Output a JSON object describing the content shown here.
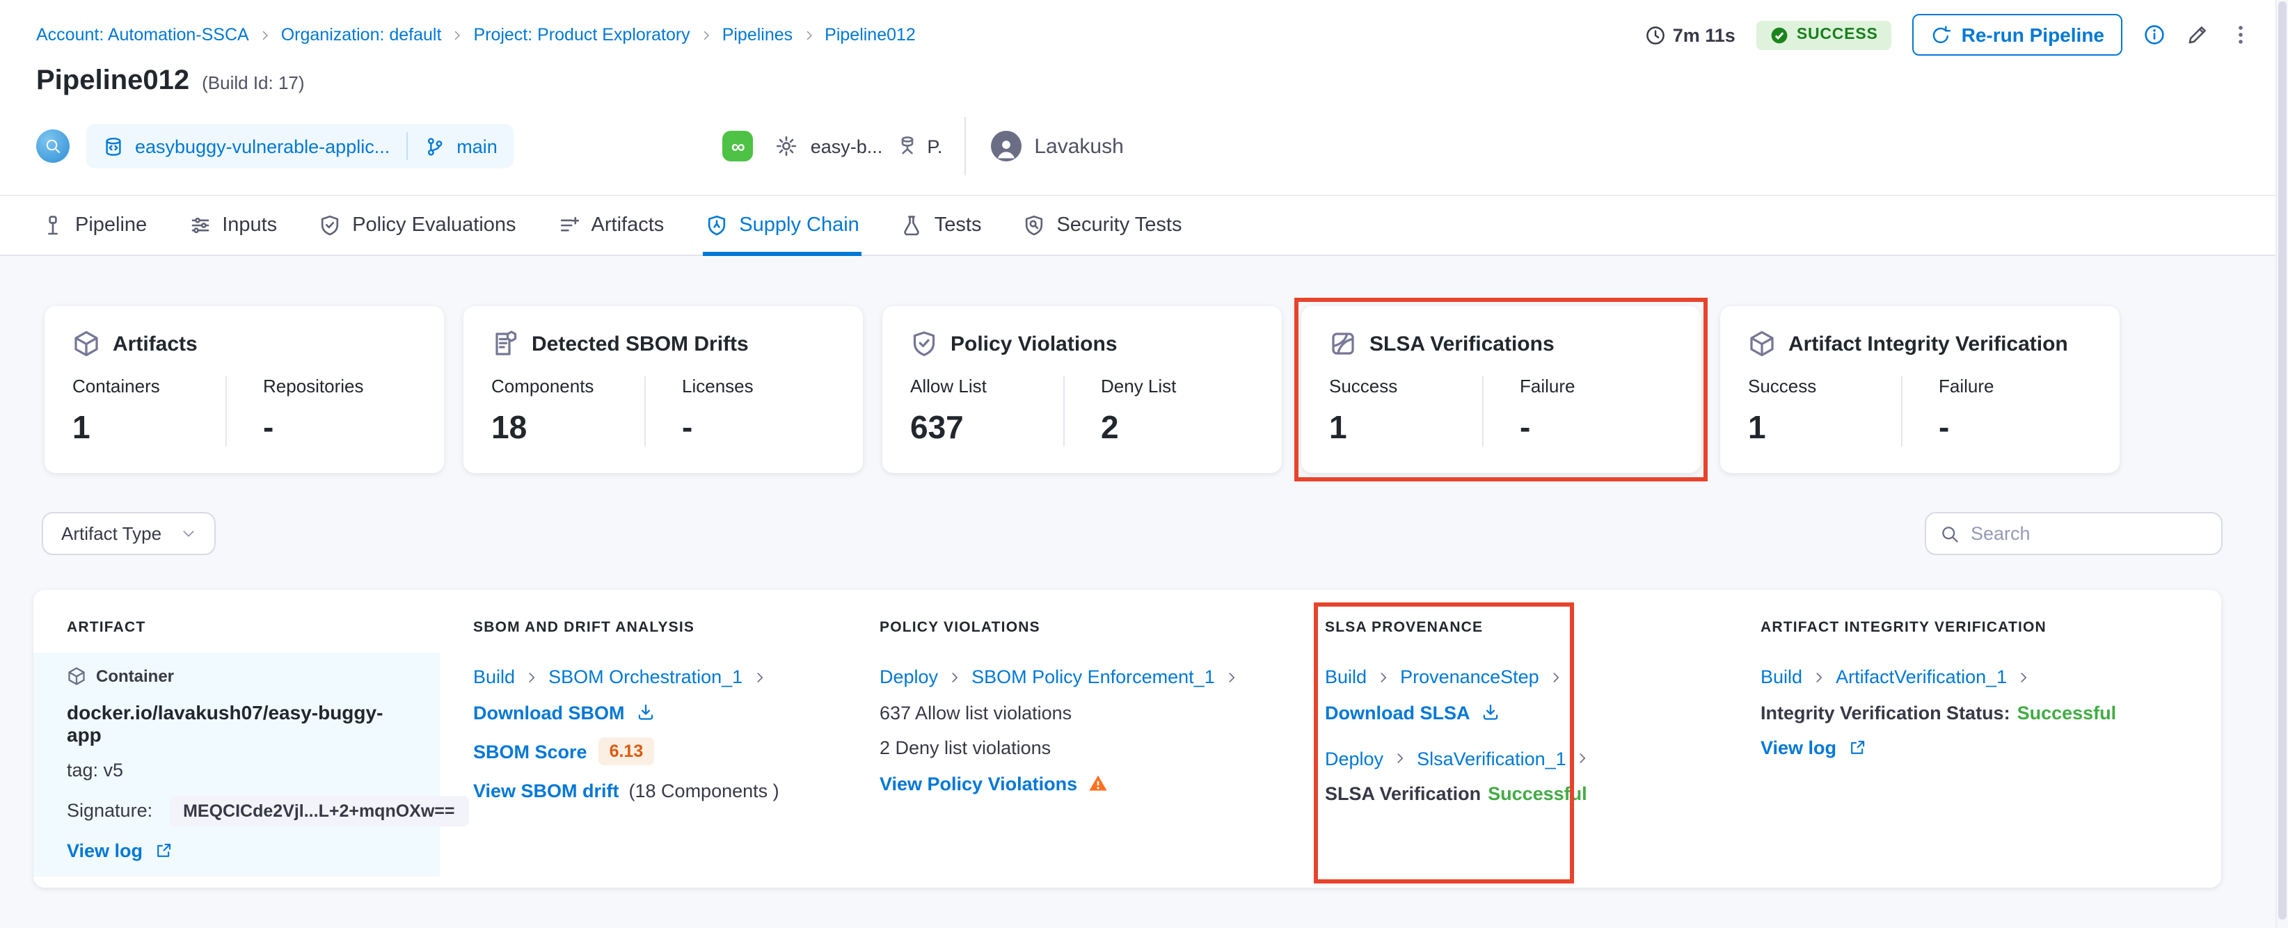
{
  "breadcrumb": {
    "items": [
      "Account: Automation-SSCA",
      "Organization: default",
      "Project: Product Exploratory",
      "Pipelines",
      "Pipeline012"
    ]
  },
  "header": {
    "duration": "7m 11s",
    "status": "SUCCESS",
    "rerun_label": "Re-run Pipeline",
    "title": "Pipeline012",
    "build_id": "(Build Id: 17)",
    "repo": "easybuggy-vulnerable-applic...",
    "branch": "main",
    "trigger_pipeline": "easy-b...",
    "trigger_initial": "P.",
    "user": "Lavakush"
  },
  "tabs": [
    {
      "label": "Pipeline",
      "active": false
    },
    {
      "label": "Inputs",
      "active": false
    },
    {
      "label": "Policy Evaluations",
      "active": false
    },
    {
      "label": "Artifacts",
      "active": false
    },
    {
      "label": "Supply Chain",
      "active": true
    },
    {
      "label": "Tests",
      "active": false
    },
    {
      "label": "Security Tests",
      "active": false
    }
  ],
  "cards": [
    {
      "title": "Artifacts",
      "icon": "cube-icon",
      "highlighted": false,
      "stats": [
        {
          "label": "Containers",
          "value": "1"
        },
        {
          "label": "Repositories",
          "value": "-"
        }
      ]
    },
    {
      "title": "Detected SBOM Drifts",
      "icon": "sbom-document-icon",
      "highlighted": false,
      "stats": [
        {
          "label": "Components",
          "value": "18"
        },
        {
          "label": "Licenses",
          "value": "-"
        }
      ]
    },
    {
      "title": "Policy Violations",
      "icon": "shield-check-icon",
      "highlighted": false,
      "stats": [
        {
          "label": "Allow List",
          "value": "637"
        },
        {
          "label": "Deny List",
          "value": "2"
        }
      ]
    },
    {
      "title": "SLSA Verifications",
      "icon": "slsa-icon",
      "highlighted": true,
      "stats": [
        {
          "label": "Success",
          "value": "1"
        },
        {
          "label": "Failure",
          "value": "-"
        }
      ]
    },
    {
      "title": "Artifact Integrity Verification",
      "icon": "cube-icon",
      "highlighted": false,
      "stats": [
        {
          "label": "Success",
          "value": "1"
        },
        {
          "label": "Failure",
          "value": "-"
        }
      ]
    }
  ],
  "filters": {
    "artifact_type_label": "Artifact Type",
    "search_placeholder": "Search"
  },
  "table": {
    "columns": [
      "ARTIFACT",
      "SBOM AND DRIFT ANALYSIS",
      "POLICY VIOLATIONS",
      "SLSA PROVENANCE",
      "ARTIFACT INTEGRITY VERIFICATION"
    ],
    "row": {
      "artifact": {
        "type_label": "Container",
        "image": "docker.io/lavakush07/easy-buggy-app",
        "tag": "tag: v5",
        "signature_label": "Signature:",
        "signature_value": "MEQCICde2Vjl...L+2+mqnOXw==",
        "view_log_label": "View log"
      },
      "sbom": {
        "stage": "Build",
        "step": "SBOM Orchestration_1",
        "download_label": "Download SBOM",
        "score_label": "SBOM Score",
        "score": "6.13",
        "drift_link": "View SBOM drift",
        "drift_suffix": "(18 Components )"
      },
      "policy": {
        "stage": "Deploy",
        "step": "SBOM Policy Enforcement_1",
        "allow_text": "637 Allow list violations",
        "deny_text": "2 Deny list violations",
        "view_label": "View Policy Violations"
      },
      "slsa": {
        "stage1": "Build",
        "step1": "ProvenanceStep",
        "download_label": "Download SLSA",
        "stage2": "Deploy",
        "step2": "SlsaVerification_1",
        "status_label": "SLSA Verification",
        "status_value": "Successful"
      },
      "integrity": {
        "stage": "Build",
        "step": "ArtifactVerification_1",
        "status_label": "Integrity Verification Status:",
        "status_value": "Successful",
        "view_log_label": "View log"
      }
    }
  },
  "colors": {
    "accent_blue": "#0278D5",
    "success_green_text": "#42AB45",
    "badge_green_bg": "#DFF3DC",
    "badge_green_text": "#17801D",
    "highlight_red": "#E8432C",
    "warning_orange": "#FF7020",
    "score_orange": "#DC5A0B",
    "page_bg": "#F6F8FB"
  }
}
